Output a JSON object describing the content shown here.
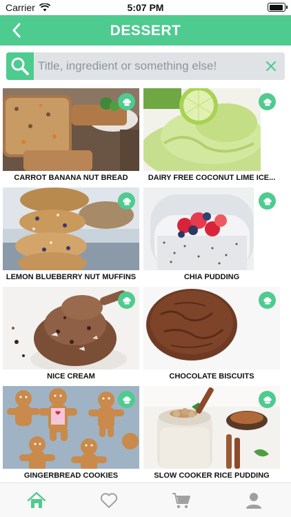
{
  "status_bar": {
    "carrier": "Carrier",
    "time": "5:07 PM",
    "battery_level": 0.95
  },
  "nav": {
    "title": "DESSERT",
    "back_icon": "chevron-left-icon"
  },
  "search": {
    "placeholder": "Title, ingredient or something else!",
    "value": "",
    "search_icon": "search-icon",
    "clear_icon": "close-icon"
  },
  "recipes": [
    {
      "title": "CARROT BANANA NUT BREAD"
    },
    {
      "title": "DAIRY FREE COCONUT LIME ICE..."
    },
    {
      "title": "LEMON BLUEBERRY NUT MUFFINS"
    },
    {
      "title": "CHIA PUDDING"
    },
    {
      "title": "NICE CREAM"
    },
    {
      "title": "CHOCOLATE BISCUITS"
    },
    {
      "title": "GINGERBREAD COOKIES"
    },
    {
      "title": "SLOW COOKER RICE PUDDING"
    }
  ],
  "tabs": [
    {
      "name": "home",
      "icon": "home-icon",
      "active": true
    },
    {
      "name": "favorites",
      "icon": "heart-icon",
      "active": false
    },
    {
      "name": "cart",
      "icon": "cart-icon",
      "active": false
    },
    {
      "name": "profile",
      "icon": "user-icon",
      "active": false
    }
  ],
  "colors": {
    "accent": "#4ecb8f",
    "tab_inactive": "#a0a0a0"
  }
}
